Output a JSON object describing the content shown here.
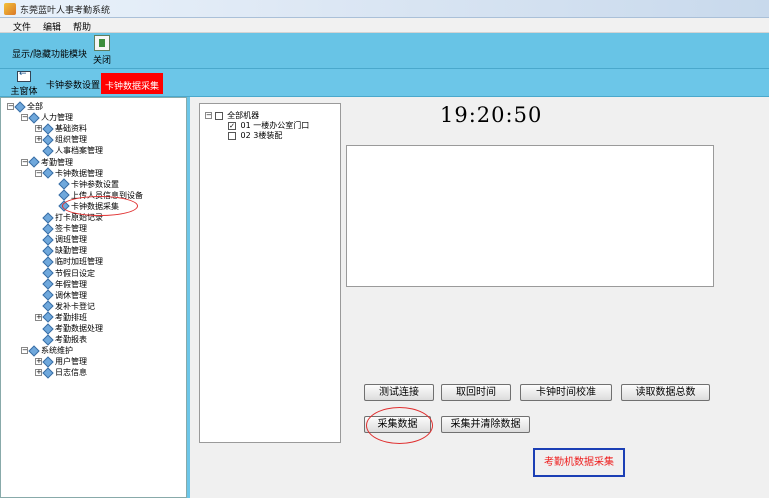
{
  "window": {
    "title": "东莞蓝叶人事考勤系统"
  },
  "menu": [
    "文件",
    "编辑",
    "帮助"
  ],
  "toolbar1": {
    "toggle_label": "显示/隐藏功能模块",
    "close_label": "关闭"
  },
  "toolbar2": {
    "main_label": "主窗体",
    "tabs": [
      "卡钟参数设置",
      "卡钟数据采集"
    ]
  },
  "tree": [
    {
      "label": "全部",
      "level": 0,
      "expander": "−"
    },
    {
      "label": "人力管理",
      "level": 1,
      "expander": "−"
    },
    {
      "label": "基础资料",
      "level": 2,
      "expander": "+"
    },
    {
      "label": "组织管理",
      "level": 2,
      "expander": "+"
    },
    {
      "label": "人事档案管理",
      "level": 2,
      "expander": ""
    },
    {
      "label": "考勤管理",
      "level": 1,
      "expander": "−"
    },
    {
      "label": "卡钟数据管理",
      "level": 2,
      "expander": "−"
    },
    {
      "label": "卡钟参数设置",
      "level": 3,
      "expander": ""
    },
    {
      "label": "上传人员信息到设备",
      "level": 3,
      "expander": ""
    },
    {
      "label": "卡钟数据采集",
      "level": 3,
      "expander": ""
    },
    {
      "label": "打卡原始记录",
      "level": 2,
      "expander": ""
    },
    {
      "label": "签卡管理",
      "level": 2,
      "expander": ""
    },
    {
      "label": "调班管理",
      "level": 2,
      "expander": ""
    },
    {
      "label": "缺勤管理",
      "level": 2,
      "expander": ""
    },
    {
      "label": "临时加班管理",
      "level": 2,
      "expander": ""
    },
    {
      "label": "节假日设定",
      "level": 2,
      "expander": ""
    },
    {
      "label": "年假管理",
      "level": 2,
      "expander": ""
    },
    {
      "label": "调休管理",
      "level": 2,
      "expander": ""
    },
    {
      "label": "发补卡登记",
      "level": 2,
      "expander": ""
    },
    {
      "label": "考勤排班",
      "level": 2,
      "expander": "+"
    },
    {
      "label": "考勤数据处理",
      "level": 2,
      "expander": ""
    },
    {
      "label": "考勤报表",
      "level": 2,
      "expander": ""
    },
    {
      "label": "系统维护",
      "level": 1,
      "expander": "−"
    },
    {
      "label": "用户管理",
      "level": 2,
      "expander": "+"
    },
    {
      "label": "日志信息",
      "level": 2,
      "expander": "+"
    }
  ],
  "machines": {
    "root": "全部机器",
    "items": [
      {
        "label": "01 一楼办公室门口",
        "checked": true
      },
      {
        "label": "02 3楼装配",
        "checked": false
      }
    ]
  },
  "clock": "19:20:50",
  "buttons": {
    "test_connection": "测试连接",
    "fetch_time": "取回时间",
    "calibrate_time": "卡钟时间校准",
    "read_total": "读取数据总数",
    "collect": "采集数据",
    "collect_clear": "采集并清除数据"
  },
  "caption": "考勤机数据采集",
  "colors": {
    "active_tab": "#ff0000",
    "toolbar": "#6cc6e8",
    "annotation": "#e03030",
    "caption_border": "#1b3fb5"
  }
}
